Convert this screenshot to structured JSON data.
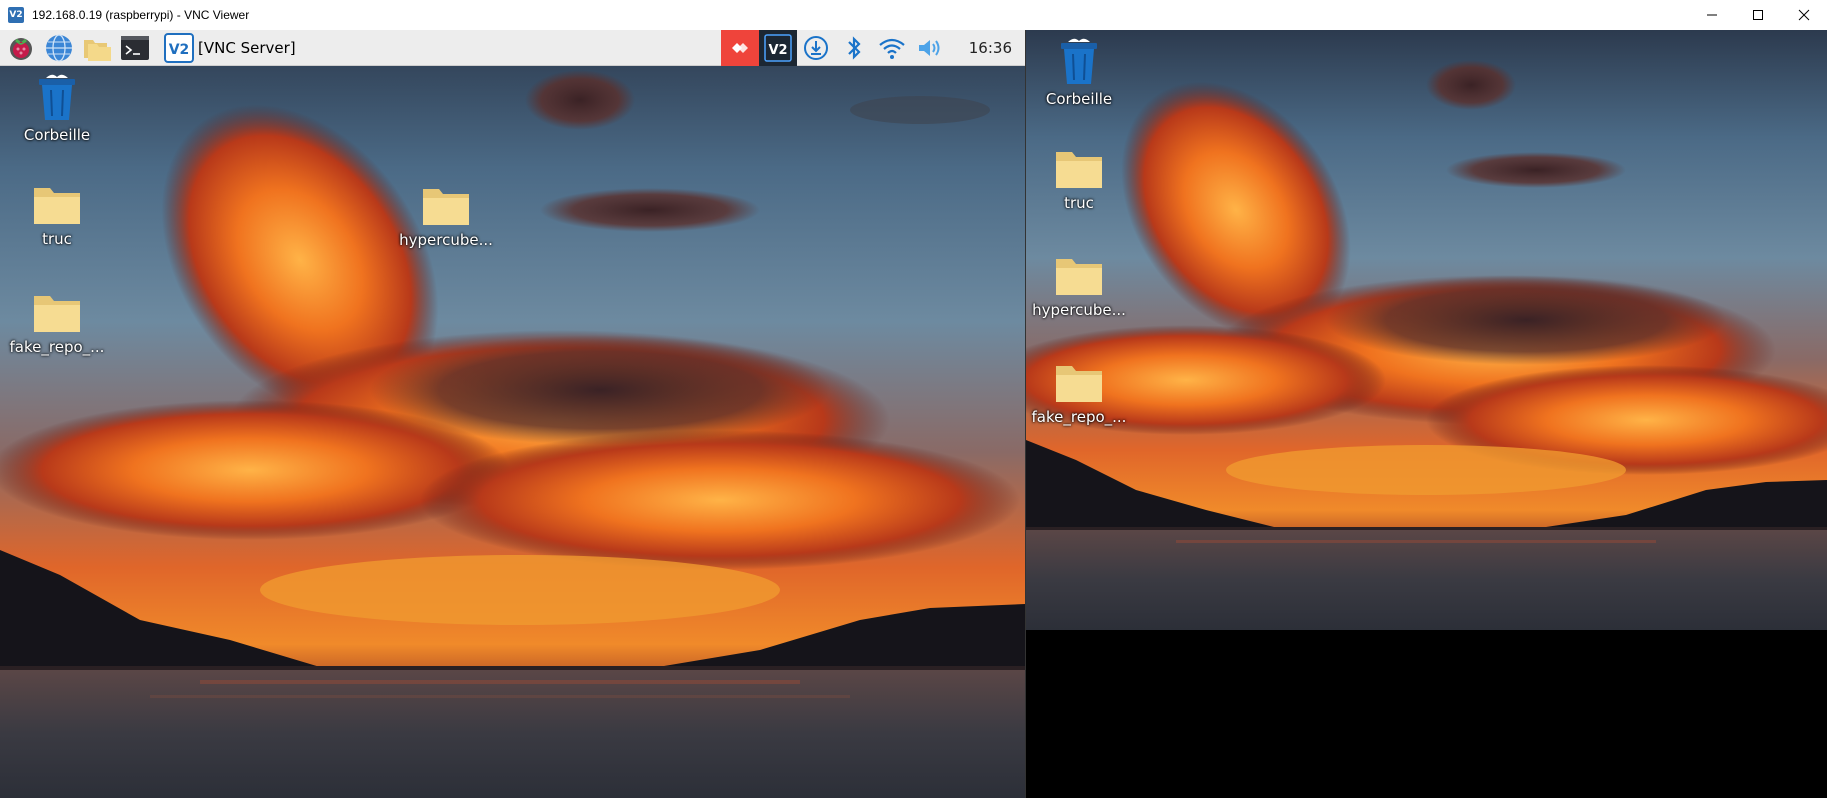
{
  "window": {
    "title": "192.168.0.19 (raspberrypi) - VNC Viewer",
    "app_icon": "vnc-viewer-icon",
    "controls": [
      "minimize-icon",
      "maximize-icon",
      "close-icon"
    ]
  },
  "panel": {
    "launchers": [
      "raspberry-menu-icon",
      "globe-browser-icon",
      "file-manager-icon",
      "terminal-icon"
    ],
    "task_label": "[VNC Server]",
    "tray": [
      "anydesk-icon",
      "vnc-server-icon",
      "download-icon",
      "bluetooth-icon",
      "wifi-icon",
      "volume-icon"
    ],
    "clock": "16:36"
  },
  "desktop_left": {
    "icons": [
      {
        "label": "Corbeille",
        "type": "trash-icon"
      },
      {
        "label": "truc",
        "type": "folder-icon"
      },
      {
        "label": "hypercube...",
        "type": "folder-icon"
      },
      {
        "label": "fake_repo_...",
        "type": "folder-icon"
      }
    ]
  },
  "desktop_right": {
    "icons": [
      {
        "label": "Corbeille",
        "type": "trash-icon"
      },
      {
        "label": "truc",
        "type": "folder-icon"
      },
      {
        "label": "hypercube...",
        "type": "folder-icon"
      },
      {
        "label": "fake_repo_...",
        "type": "folder-icon"
      }
    ]
  },
  "colors": {
    "panel_bg": "#ededed",
    "folder": "#f4d98a",
    "trash": "#1a73c9",
    "anydesk_red": "#ef443b",
    "vnc_blue": "#1f6fbf"
  }
}
